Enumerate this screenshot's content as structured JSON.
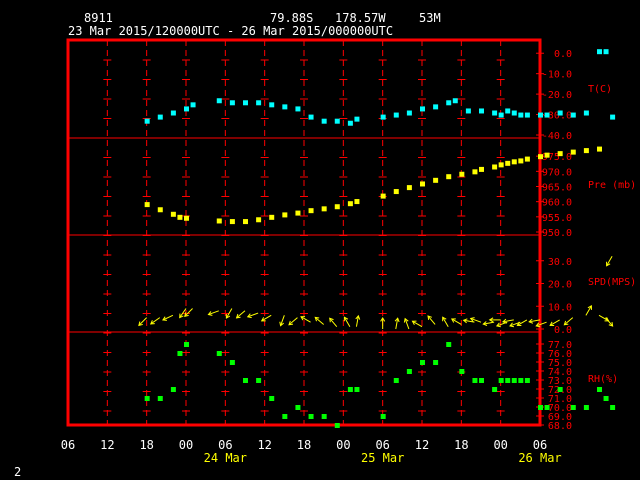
{
  "header": {
    "station": "8911",
    "lat": "79.88S",
    "lon": "178.57W",
    "elev": "53M",
    "range": "23 Mar 2015/120000UTC - 26 Mar 2015/000000UTC"
  },
  "page_number": "2",
  "chart_data": {
    "type": "scatter",
    "x_unit": "hours since 2015-03-23 06 UTC",
    "x_ticks": [
      0,
      6,
      12,
      18,
      24,
      30,
      36,
      42,
      48,
      54,
      60,
      66,
      72
    ],
    "x_tick_labels": [
      "06",
      "12",
      "18",
      "00",
      "06",
      "12",
      "18",
      "00",
      "06",
      "12",
      "18",
      "00",
      "06"
    ],
    "x_day_labels": [
      {
        "x": 24,
        "label": "24 Mar"
      },
      {
        "x": 48,
        "label": "25 Mar"
      },
      {
        "x": 72,
        "label": "26 Mar"
      }
    ],
    "xlim": [
      0,
      72
    ],
    "panels": [
      {
        "name": "T(C)",
        "ylim": [
          -40,
          5
        ],
        "yticks": [
          0,
          -10,
          -20,
          -30,
          -40
        ],
        "ytick_labels": [
          "0.0",
          "-10.0",
          "-20.0",
          "-30.0",
          "-40.0"
        ],
        "color": "#00ffff",
        "x": [
          12,
          14,
          16,
          18,
          19,
          23,
          25,
          27,
          29,
          31,
          33,
          35,
          37,
          39,
          41,
          43,
          44,
          48,
          50,
          52,
          54,
          56,
          58,
          59,
          61,
          63,
          65,
          66,
          67,
          68,
          69,
          70,
          72,
          73,
          75,
          77,
          79,
          81,
          82,
          83
        ],
        "y": [
          -33,
          -31,
          -29,
          -27,
          -25,
          -23,
          -24,
          -24,
          -24,
          -25,
          -26,
          -27,
          -31,
          -33,
          -33,
          -34,
          -32,
          -31,
          -30,
          -29,
          -27,
          -26,
          -24,
          -23,
          -28,
          -28,
          -29,
          -30,
          -28,
          -29,
          -30,
          -30,
          -30,
          -30,
          -29,
          -30,
          -29,
          1,
          1,
          -31
        ]
      },
      {
        "name": "Pre (mb)",
        "ylim": [
          950,
          980
        ],
        "yticks": [
          950,
          955,
          960,
          965,
          970,
          975
        ],
        "ytick_labels": [
          "950.0",
          "955.0",
          "960.0",
          "965.0",
          "970.0",
          "975.0"
        ],
        "color": "#ffff00",
        "x": [
          12,
          14,
          16,
          17,
          18,
          23,
          25,
          27,
          29,
          31,
          33,
          35,
          37,
          39,
          41,
          43,
          44,
          48,
          50,
          52,
          54,
          56,
          58,
          60,
          62,
          63,
          65,
          66,
          67,
          68,
          69,
          70,
          72,
          73,
          75,
          77,
          79,
          81
        ],
        "y": [
          959.2,
          957.5,
          956.0,
          955.0,
          954.7,
          953.8,
          953.6,
          953.6,
          954.2,
          955.0,
          955.8,
          956.4,
          957.2,
          957.8,
          958.5,
          959.5,
          960.2,
          962.0,
          963.5,
          964.8,
          966.0,
          967.2,
          968.4,
          969.2,
          970.0,
          970.8,
          971.6,
          972.3,
          972.8,
          973.3,
          973.6,
          974.2,
          975.0,
          975.5,
          976.0,
          976.5,
          977.0,
          977.5
        ]
      },
      {
        "name": "SPD(MPS)",
        "ylim": [
          0,
          40
        ],
        "yticks": [
          0,
          10,
          20,
          30
        ],
        "ytick_labels": [
          "0.0",
          "10.0",
          "20.0",
          "30.0"
        ],
        "color": "#ffff00",
        "x": [
          12,
          14,
          16,
          18,
          19,
          23,
          25,
          27,
          29,
          31,
          33,
          35,
          37,
          39,
          41,
          43,
          44,
          48,
          50,
          52,
          54,
          56,
          58,
          60,
          62,
          63,
          65,
          66,
          67,
          68,
          69,
          70,
          72,
          73,
          75,
          77,
          79,
          81,
          82,
          83
        ],
        "y": [
          5,
          5,
          6,
          9,
          9,
          8,
          9,
          8,
          7,
          6,
          6,
          5,
          3,
          2,
          1,
          1,
          1,
          0,
          0,
          0,
          1,
          2,
          1,
          2,
          3,
          3,
          3,
          4,
          3,
          4,
          3,
          4,
          4,
          3,
          4,
          5,
          6,
          6,
          5,
          32
        ],
        "dir": [
          225,
          235,
          245,
          215,
          225,
          250,
          210,
          230,
          250,
          240,
          200,
          230,
          300,
          310,
          320,
          330,
          10,
          0,
          10,
          340,
          300,
          320,
          330,
          300,
          280,
          290,
          260,
          270,
          250,
          260,
          250,
          240,
          260,
          250,
          240,
          230,
          30,
          120,
          140,
          210
        ]
      },
      {
        "name": "RH(%)",
        "ylim": [
          68,
          77
        ],
        "yticks": [
          77,
          76,
          75,
          74,
          73,
          72,
          71,
          70,
          69,
          68
        ],
        "ytick_labels": [
          "77.0",
          "76.0",
          "75.0",
          "74.0",
          "73.0",
          "72.0",
          "71.0",
          "70.0",
          "69.0",
          "68.0"
        ],
        "color": "#00ff00",
        "x": [
          12,
          14,
          16,
          17,
          18,
          23,
          25,
          27,
          29,
          31,
          33,
          35,
          37,
          39,
          41,
          43,
          44,
          48,
          50,
          52,
          54,
          56,
          58,
          60,
          62,
          63,
          65,
          66,
          67,
          68,
          69,
          70,
          72,
          73,
          75,
          77,
          79,
          81,
          82,
          83
        ],
        "y": [
          71,
          71,
          72,
          76,
          77,
          76,
          75,
          73,
          73,
          71,
          69,
          70,
          69,
          69,
          68,
          72,
          72,
          69,
          73,
          74,
          75,
          75,
          77,
          74,
          73,
          73,
          72,
          73,
          73,
          73,
          73,
          73,
          70,
          70,
          72,
          70,
          70,
          72,
          71,
          70
        ]
      }
    ]
  }
}
